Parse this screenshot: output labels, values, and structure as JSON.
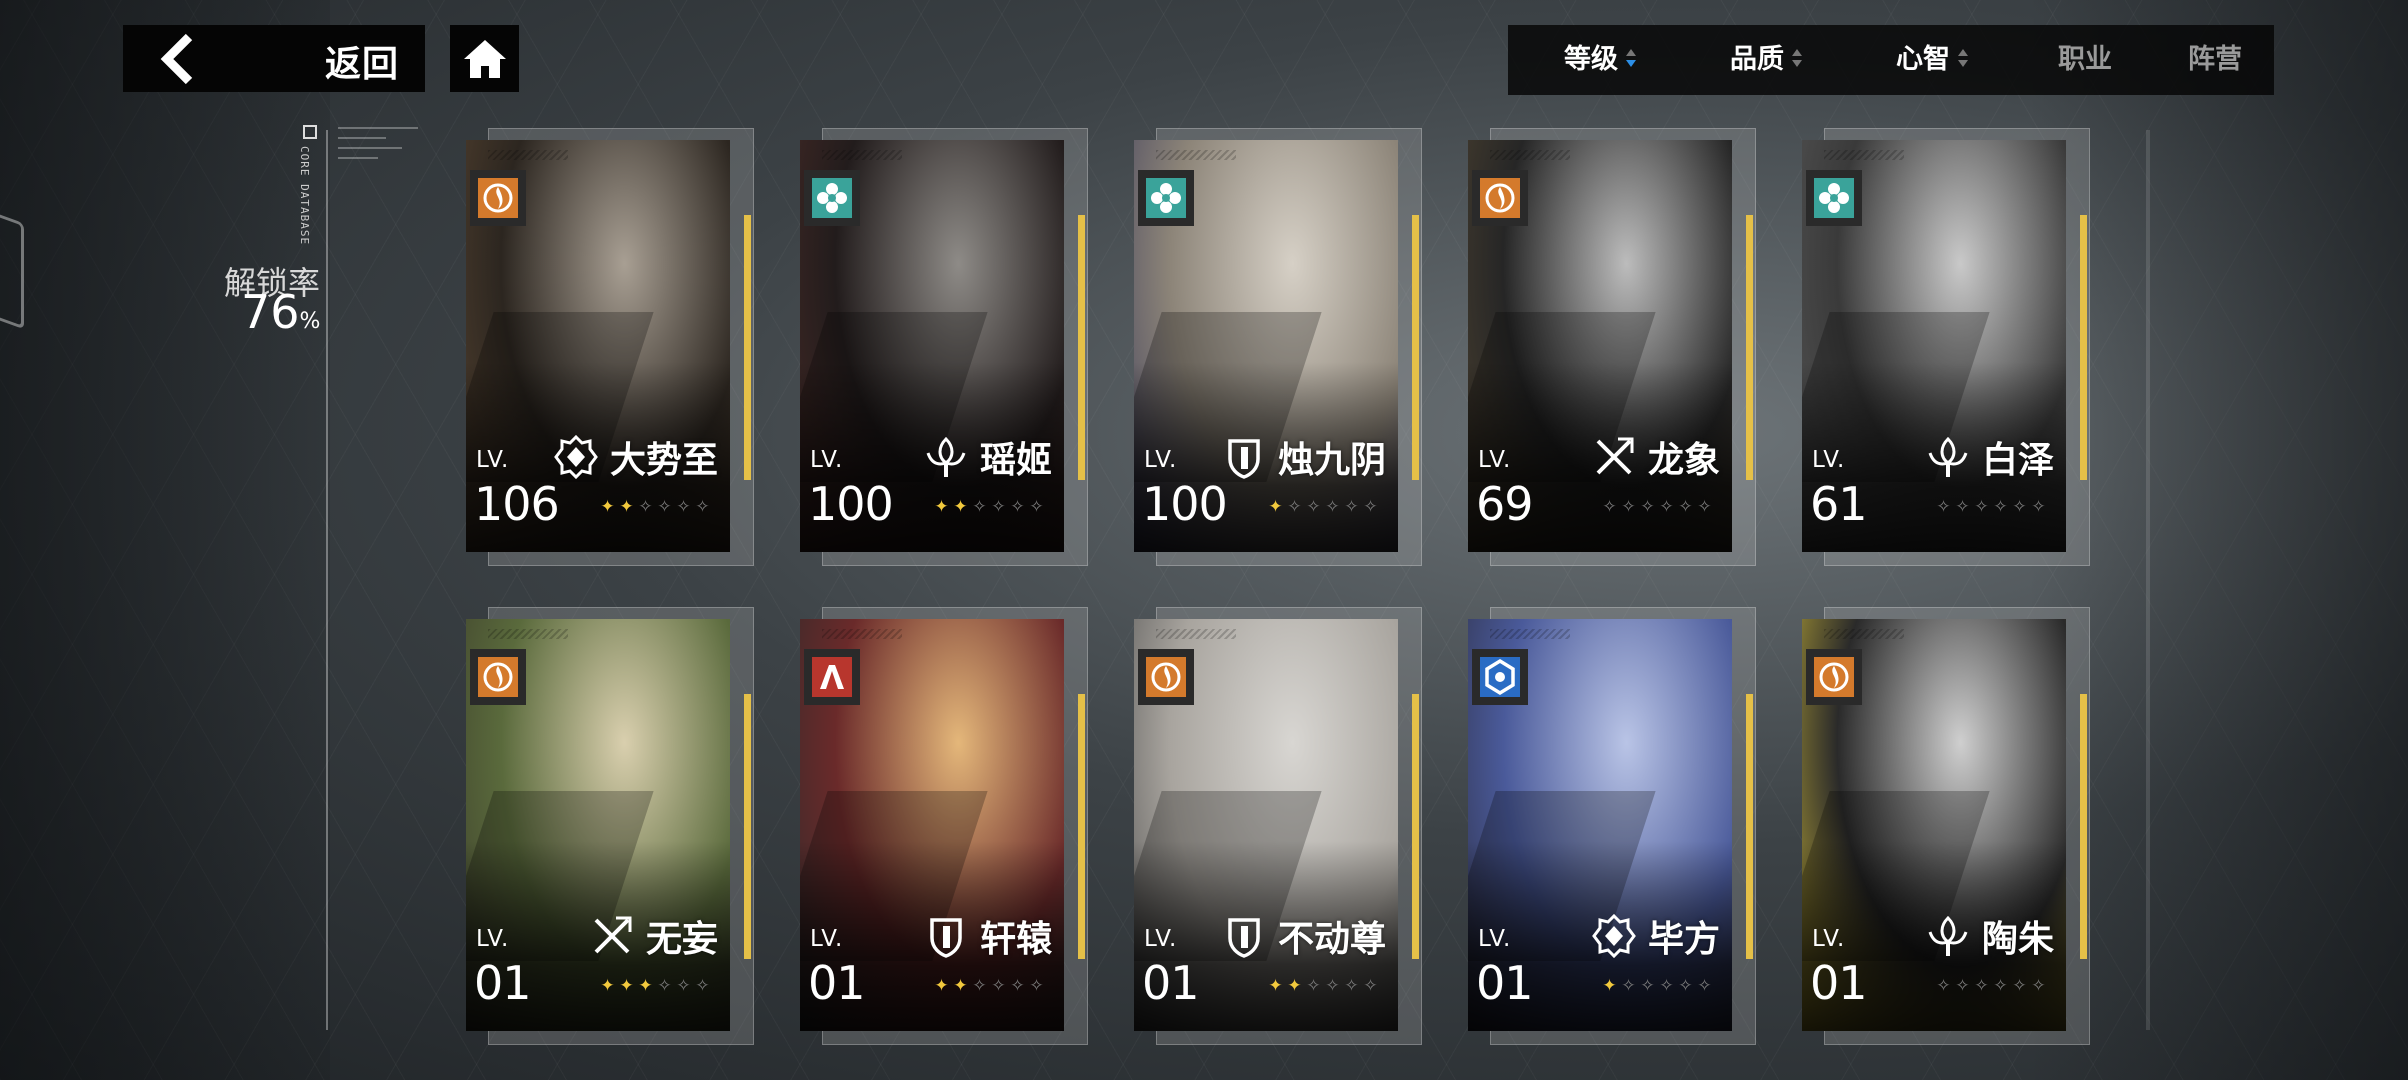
{
  "header": {
    "back_label": "返回"
  },
  "sort_bar": {
    "items": [
      {
        "label": "等级",
        "arrow": "active-down"
      },
      {
        "label": "品质",
        "arrow": "both"
      },
      {
        "label": "心智",
        "arrow": "both"
      },
      {
        "label": "职业",
        "arrow": "none"
      },
      {
        "label": "阵营",
        "arrow": "none"
      }
    ],
    "active_arrow_color": "#2c8fe6"
  },
  "sidebar": {
    "database_label": "CORE DATABASE",
    "unlock_label": "解锁率",
    "unlock_value": "76",
    "unlock_unit": "%"
  },
  "colors": {
    "accent_yellow": "#e5c048",
    "star_on": "#f2c93d",
    "badge_orange": "#d47a2c",
    "badge_teal": "#3aa39a",
    "badge_red": "#b8362d",
    "badge_blue": "#2a6cc4"
  },
  "cards": [
    {
      "name": "大势至",
      "lv_label": "LV.",
      "level": "106",
      "stars_on": 2,
      "stars_total": 6,
      "badge": "orange-flame-icon",
      "class_icon": "gear-shield-icon",
      "art": [
        "#a89f93",
        "#2c2620",
        "#5a4632"
      ]
    },
    {
      "name": "瑶姬",
      "lv_label": "LV.",
      "level": "100",
      "stars_on": 2,
      "stars_total": 6,
      "badge": "teal-clover-icon",
      "class_icon": "fleur-icon",
      "art": [
        "#8e8b87",
        "#221c1c",
        "#4b2c28"
      ]
    },
    {
      "name": "烛九阴",
      "lv_label": "LV.",
      "level": "100",
      "stars_on": 1,
      "stars_total": 6,
      "badge": "teal-clover-icon",
      "class_icon": "shield-icon",
      "art": [
        "#d6d0c6",
        "#8c8478",
        "#3c3c5a"
      ]
    },
    {
      "name": "龙象",
      "lv_label": "LV.",
      "level": "69",
      "stars_on": 0,
      "stars_total": 6,
      "badge": "orange-flame-icon",
      "class_icon": "crossed-swords-icon",
      "art": [
        "#bcbcbc",
        "#262626",
        "#524632"
      ]
    },
    {
      "name": "白泽",
      "lv_label": "LV.",
      "level": "61",
      "stars_on": 0,
      "stars_total": 6,
      "badge": "teal-clover-icon",
      "class_icon": "fleur-icon",
      "art": [
        "#c9c9c9",
        "#3a3a3a",
        "#595959"
      ]
    },
    {
      "name": "无妄",
      "lv_label": "LV.",
      "level": "01",
      "stars_on": 3,
      "stars_total": 6,
      "badge": "orange-flame-icon",
      "class_icon": "crossed-swords-icon",
      "art": [
        "#d9cfae",
        "#5a6a3c",
        "#3a3a2a"
      ]
    },
    {
      "name": "轩辕",
      "lv_label": "LV.",
      "level": "01",
      "stars_on": 2,
      "stars_total": 6,
      "badge": "red-pillar-icon",
      "class_icon": "shield-icon",
      "art": [
        "#e4b77a",
        "#6a2a2a",
        "#2a2a2a"
      ]
    },
    {
      "name": "不动尊",
      "lv_label": "LV.",
      "level": "01",
      "stars_on": 2,
      "stars_total": 6,
      "badge": "orange-flame-icon",
      "class_icon": "shield-icon",
      "art": [
        "#d8d6d2",
        "#a8a49e",
        "#4a4a4a"
      ]
    },
    {
      "name": "毕方",
      "lv_label": "LV.",
      "level": "01",
      "stars_on": 1,
      "stars_total": 6,
      "badge": "blue-hex-icon",
      "class_icon": "gear-shield-icon",
      "art": [
        "#b9c4e6",
        "#4a5a9a",
        "#2a2a3a"
      ]
    },
    {
      "name": "陶朱",
      "lv_label": "LV.",
      "level": "01",
      "stars_on": 0,
      "stars_total": 6,
      "badge": "orange-flame-icon",
      "class_icon": "fleur-icon",
      "art": [
        "#cfcfcf",
        "#2a2a2a",
        "#d8c23a"
      ]
    }
  ]
}
